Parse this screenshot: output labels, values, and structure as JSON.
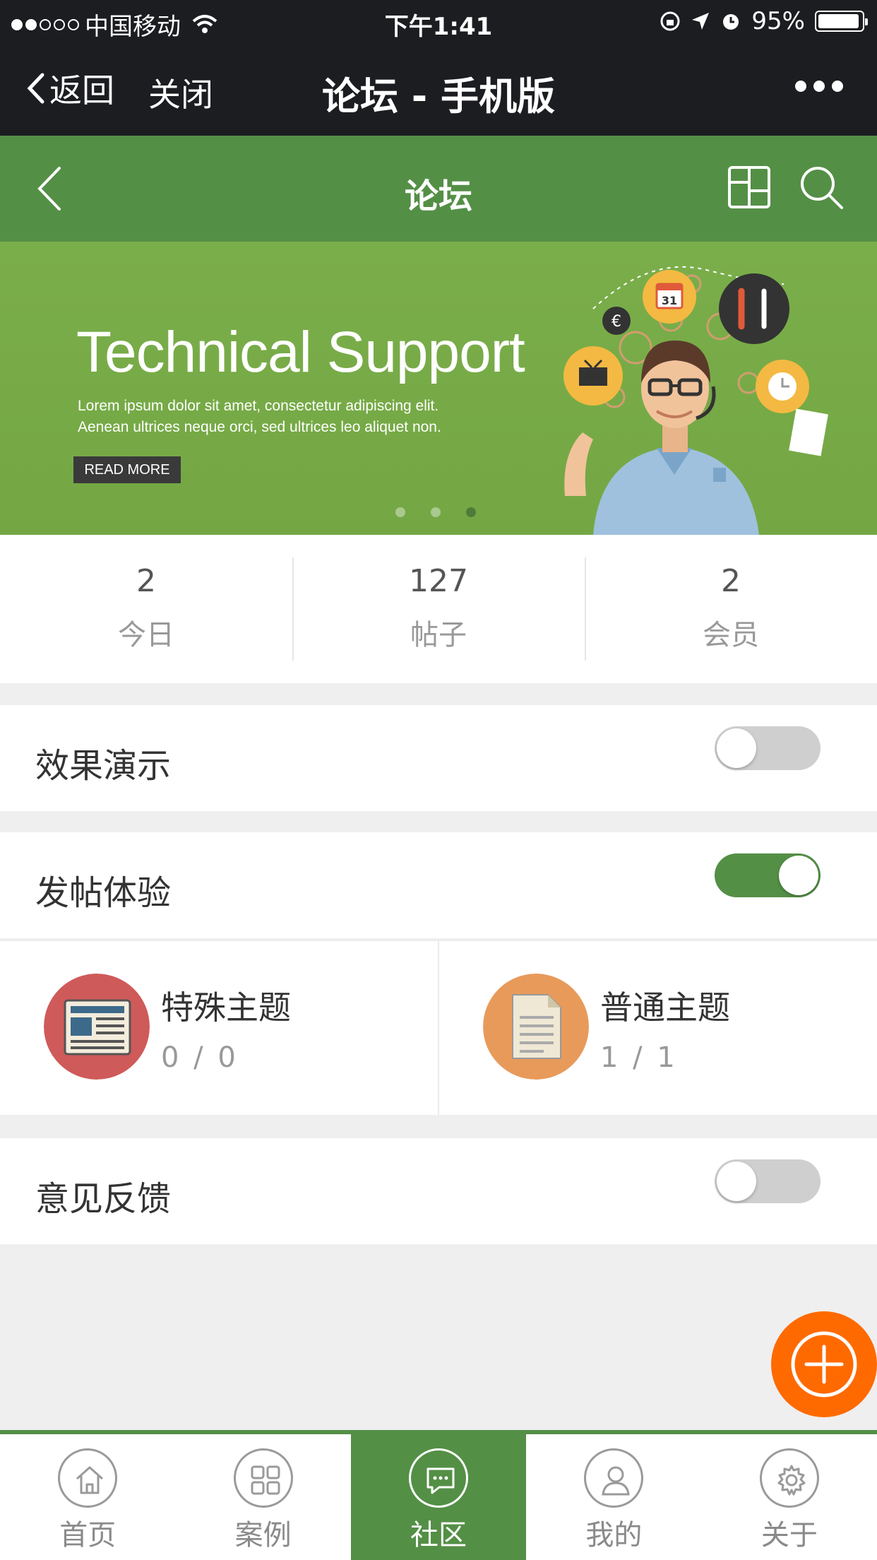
{
  "status_bar": {
    "carrier": "中国移动",
    "time": "下午1:41",
    "battery": "95%",
    "battery_level": 0.95
  },
  "wx_header": {
    "back_label": "返回",
    "close_label": "关闭",
    "title": "论坛 - 手机版"
  },
  "app_header": {
    "title": "论坛"
  },
  "banner": {
    "title": "Technical Support",
    "subtitle_line1": "Lorem ipsum dolor sit amet, consectetur adipiscing elit.",
    "subtitle_line2": "Aenean ultrices neque orci, sed ultrices leo aliquet non.",
    "button_label": "READ MORE",
    "calendar_day": "31",
    "slide_count": 3,
    "active_slide": 3
  },
  "stats": [
    {
      "value": "2",
      "label": "今日"
    },
    {
      "value": "127",
      "label": "帖子"
    },
    {
      "value": "2",
      "label": "会员"
    }
  ],
  "sections": [
    {
      "label": "效果演示",
      "expanded": false
    },
    {
      "label": "发帖体验",
      "expanded": true
    },
    {
      "label": "意见反馈",
      "expanded": false
    }
  ],
  "topics": [
    {
      "title": "特殊主题",
      "count": "0 / 0",
      "color": "#cf5a5a"
    },
    {
      "title": "普通主题",
      "count": "1 / 1",
      "color": "#e89a5a"
    }
  ],
  "tabbar": [
    {
      "label": "首页",
      "icon": "home-icon",
      "active": false
    },
    {
      "label": "案例",
      "icon": "grid-icon",
      "active": false
    },
    {
      "label": "社区",
      "icon": "chat-icon",
      "active": true
    },
    {
      "label": "我的",
      "icon": "user-icon",
      "active": false
    },
    {
      "label": "关于",
      "icon": "gear-icon",
      "active": false
    }
  ],
  "colors": {
    "brand_green": "#548f46",
    "banner_green": "#7aae4a",
    "fab_orange": "#ff6a00",
    "header_dark": "#1c1d21"
  }
}
